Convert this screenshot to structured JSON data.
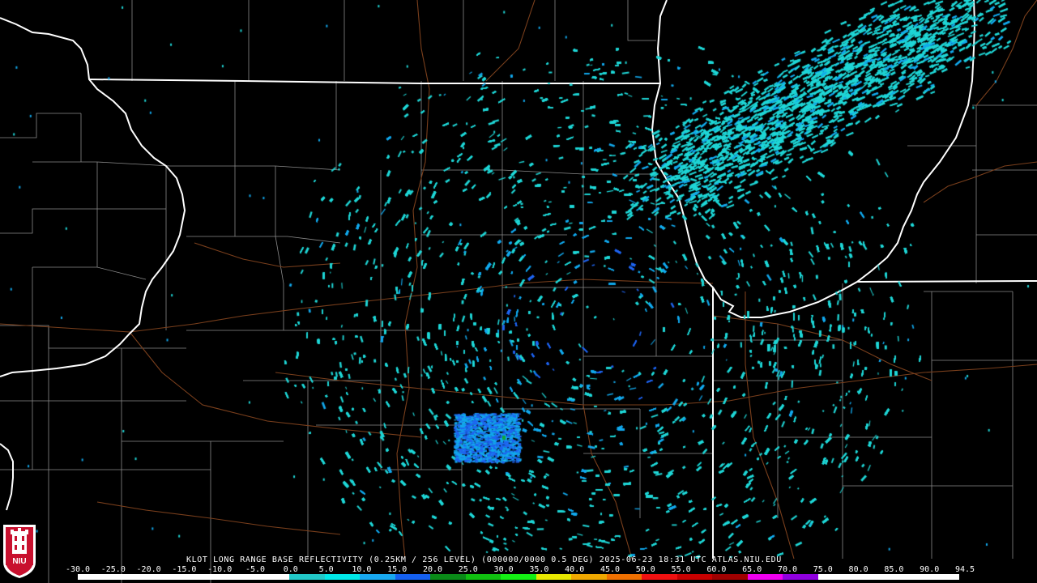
{
  "header": {
    "caption": "KLOT LONG RANGE BASE REFLECTIVITY (0.25KM / 256 LEVEL) (000000/0000 0.5 DEG) 2025-06-23 18:31 UTC  ATLAS.NIU.EDU"
  },
  "logo": {
    "text": "NIU",
    "colors": {
      "red": "#c8102e",
      "white": "#ffffff",
      "black": "#000000"
    }
  },
  "colors": {
    "background": "#000000",
    "state_border": "#ffffff",
    "county_border": "#8a8a8a",
    "highway": "#7a3f1c"
  },
  "scale": {
    "labels": [
      "-30.0",
      "-25.0",
      "-20.0",
      "-15.0",
      "-10.0",
      "-5.0",
      "0.0",
      "5.0",
      "10.0",
      "15.0",
      "20.0",
      "25.0",
      "30.0",
      "35.0",
      "40.0",
      "45.0",
      "50.0",
      "55.0",
      "60.0",
      "65.0",
      "70.0",
      "75.0",
      "80.0",
      "85.0",
      "90.0",
      "94.5"
    ],
    "colors": [
      "#ffffff",
      "#ffffff",
      "#ffffff",
      "#ffffff",
      "#ffffff",
      "#ffffff",
      "#22c8c8",
      "#00e8e8",
      "#18a8f0",
      "#1460f0",
      "#0a8a18",
      "#10c010",
      "#14f014",
      "#e8e800",
      "#f0a800",
      "#f07000",
      "#f01010",
      "#c80000",
      "#a00000",
      "#f000f0",
      "#9000e0",
      "#ffffff",
      "#ffffff",
      "#ffffff",
      "#ffffff"
    ]
  },
  "radar": {
    "site_label": "KLOT",
    "colors": {
      "light": "#1fd6d6",
      "mid": "#12a8ec",
      "dark": "#1f64f0",
      "green": "#0fa83a"
    }
  }
}
